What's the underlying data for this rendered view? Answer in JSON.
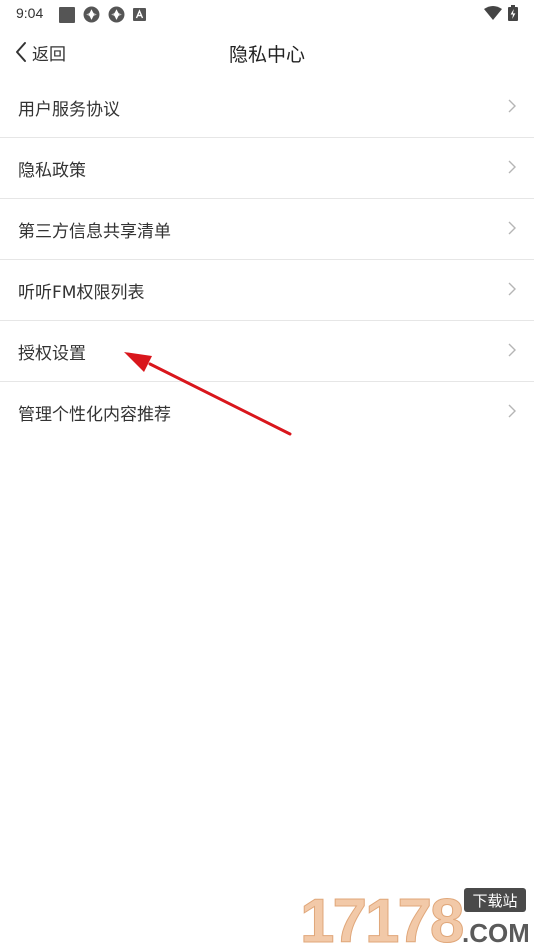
{
  "status_bar": {
    "time": "9:04"
  },
  "nav": {
    "back_label": "返回",
    "title": "隐私中心"
  },
  "menu": {
    "items": [
      {
        "label": "用户服务协议"
      },
      {
        "label": "隐私政策"
      },
      {
        "label": "第三方信息共享清单"
      },
      {
        "label": "听听FM权限列表"
      },
      {
        "label": "授权设置"
      },
      {
        "label": "管理个性化内容推荐"
      }
    ]
  },
  "annotation": {
    "color": "#d9161c"
  },
  "watermark": {
    "number": "17178",
    "tag": "下载站",
    "domain": ".COM"
  }
}
